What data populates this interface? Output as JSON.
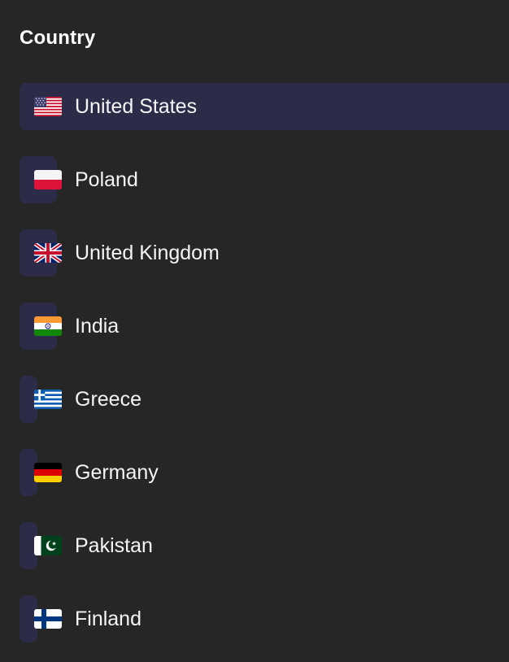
{
  "header": {
    "title": "Country"
  },
  "countries": [
    {
      "label": "United States",
      "flag_icon": "us-flag-icon",
      "selected": true
    },
    {
      "label": "Poland",
      "flag_icon": "pl-flag-icon",
      "selected": false
    },
    {
      "label": "United Kingdom",
      "flag_icon": "gb-flag-icon",
      "selected": false
    },
    {
      "label": "India",
      "flag_icon": "in-flag-icon",
      "selected": false
    },
    {
      "label": "Greece",
      "flag_icon": "gr-flag-icon",
      "selected": false
    },
    {
      "label": "Germany",
      "flag_icon": "de-flag-icon",
      "selected": false
    },
    {
      "label": "Pakistan",
      "flag_icon": "pk-flag-icon",
      "selected": false
    },
    {
      "label": "Finland",
      "flag_icon": "fi-flag-icon",
      "selected": false
    }
  ],
  "colors": {
    "background": "#262626",
    "highlight": "#2c2c48",
    "text": "#f5f5f5"
  }
}
